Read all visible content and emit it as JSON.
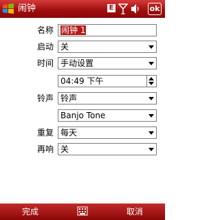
{
  "titlebar": {
    "title": "闹钟",
    "network_badge": "E",
    "ok_label": "ok"
  },
  "form": {
    "name": {
      "label": "名称",
      "value": "闹钟 1"
    },
    "enabled": {
      "label": "启动",
      "value": "关"
    },
    "time_mode": {
      "label": "时间",
      "value": "手动设置"
    },
    "time_value": {
      "value": "04:49 下午"
    },
    "ringtone_type": {
      "label": "铃声",
      "value": "铃声"
    },
    "ringtone_name": {
      "value": "Banjo Tone"
    },
    "repeat": {
      "label": "重复",
      "value": "每天"
    },
    "snooze": {
      "label": "再响",
      "value": "关"
    }
  },
  "softkeys": {
    "left": "完成",
    "right": "取消"
  },
  "colors": {
    "accent": "#a10f0f",
    "selection": "#b41c1c"
  },
  "icons": [
    "windows-start-icon",
    "signal-icon",
    "speaker-icon",
    "keyboard-icon"
  ]
}
